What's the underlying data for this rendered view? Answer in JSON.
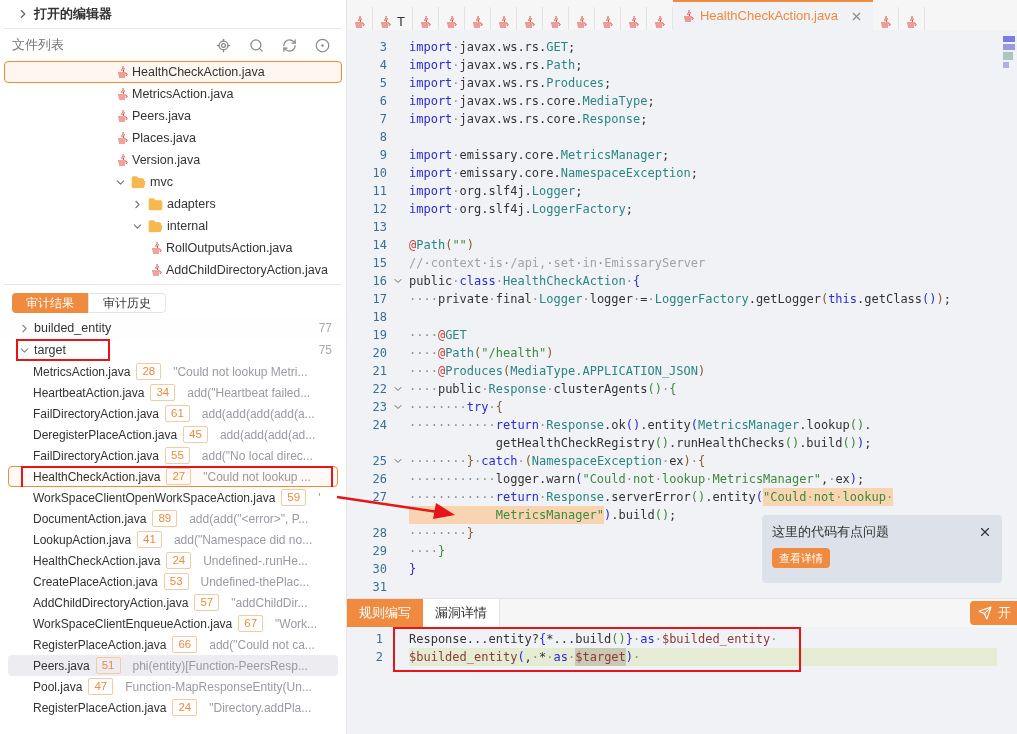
{
  "sidebar": {
    "open_editors": {
      "label": "打开的编辑器",
      "expanded": false
    },
    "file_list": {
      "title": "文件列表"
    },
    "tree": [
      {
        "kind": "file",
        "name": "HealthCheckAction.java",
        "selected": true
      },
      {
        "kind": "file",
        "name": "MetricsAction.java",
        "selected": false
      },
      {
        "kind": "file",
        "name": "Peers.java",
        "selected": false
      },
      {
        "kind": "file",
        "name": "Places.java",
        "selected": false
      },
      {
        "kind": "file",
        "name": "Version.java",
        "selected": false
      },
      {
        "kind": "folder",
        "name": "mvc",
        "expanded": true,
        "selected": false,
        "children": [
          {
            "kind": "folder",
            "name": "adapters",
            "expanded": false,
            "selected": false
          },
          {
            "kind": "folder",
            "name": "internal",
            "expanded": true,
            "selected": false,
            "children": [
              {
                "kind": "file",
                "name": "RollOutputsAction.java",
                "selected": false
              },
              {
                "kind": "file",
                "name": "AddChildDirectoryAction.java",
                "selected": false
              }
            ]
          }
        ]
      }
    ],
    "audit_tabs": [
      {
        "label": "审计结果",
        "selected": true
      },
      {
        "label": "审计历史",
        "selected": false
      }
    ],
    "results": [
      {
        "name": "builded_entity",
        "count": "77",
        "expanded": false,
        "framed": false
      },
      {
        "name": "target",
        "count": "75",
        "expanded": true,
        "framed": true,
        "children": [
          {
            "file": "MetricsAction.java",
            "line": "28",
            "snippet": "\"Could not lookup Metri...",
            "selected": false,
            "hovered": false
          },
          {
            "file": "HeartbeatAction.java",
            "line": "34",
            "snippet": "add(\"Heartbeat failed...",
            "selected": false,
            "hovered": false
          },
          {
            "file": "FailDirectoryAction.java",
            "line": "61",
            "snippet": "add(add(add(add(a...",
            "selected": false,
            "hovered": false
          },
          {
            "file": "DeregisterPlaceAction.java",
            "line": "45",
            "snippet": "add(add(add(ad...",
            "selected": false,
            "hovered": false
          },
          {
            "file": "FailDirectoryAction.java",
            "line": "55",
            "snippet": "add(\"No local direc...",
            "selected": false,
            "hovered": false
          },
          {
            "file": "HealthCheckAction.java",
            "line": "27",
            "snippet": "\"Could not lookup ...",
            "selected": true,
            "hovered": false
          },
          {
            "file": "WorkSpaceClientOpenWorkSpaceAction.java",
            "line": "59",
            "snippet": "'",
            "selected": false,
            "hovered": false
          },
          {
            "file": "DocumentAction.java",
            "line": "89",
            "snippet": "add(add(\"<error>\", P...",
            "selected": false,
            "hovered": false
          },
          {
            "file": "LookupAction.java",
            "line": "41",
            "snippet": "add(\"Namespace did no...",
            "selected": false,
            "hovered": false
          },
          {
            "file": "HealthCheckAction.java",
            "line": "24",
            "snippet": "Undefined-.runHe...",
            "selected": false,
            "hovered": false
          },
          {
            "file": "CreatePlaceAction.java",
            "line": "53",
            "snippet": "Undefined-thePlac...",
            "selected": false,
            "hovered": false
          },
          {
            "file": "AddChildDirectoryAction.java",
            "line": "57",
            "snippet": "\"addChildDir...",
            "selected": false,
            "hovered": false
          },
          {
            "file": "WorkSpaceClientEnqueueAction.java",
            "line": "67",
            "snippet": "\"Work...",
            "selected": false,
            "hovered": false
          },
          {
            "file": "RegisterPlaceAction.java",
            "line": "66",
            "snippet": "add(\"Could not ca...",
            "selected": false,
            "hovered": false
          },
          {
            "file": "Peers.java",
            "line": "51",
            "snippet": "phi(entity)[Function-PeersResp...",
            "selected": false,
            "hovered": true
          },
          {
            "file": "Pool.java",
            "line": "47",
            "snippet": "Function-MapResponseEntity(Un...",
            "selected": false,
            "hovered": false
          },
          {
            "file": "RegisterPlaceAction.java",
            "line": "24",
            "snippet": "\"Directory.addPla...",
            "selected": false,
            "hovered": false
          }
        ]
      }
    ]
  },
  "editor_tabs": [
    {
      "selected": false
    },
    {
      "label": "T",
      "selected": false
    },
    {
      "selected": false
    },
    {
      "selected": false
    },
    {
      "selected": false
    },
    {
      "selected": false
    },
    {
      "selected": false
    },
    {
      "selected": false
    },
    {
      "selected": false
    },
    {
      "selected": false
    },
    {
      "selected": false
    },
    {
      "selected": false
    },
    {
      "label": "HealthCheckAction.java",
      "selected": true
    },
    {
      "selected": false
    },
    {
      "selected": false
    }
  ],
  "code": [
    {
      "kind": "line",
      "number": "3",
      "tokens": [
        {
          "text": "import",
          "kind": "k"
        },
        {
          "text": "·javax.ws.rs.",
          "kind": "p"
        },
        {
          "text": "GET",
          "kind": "t"
        },
        {
          "text": ";",
          "kind": "p"
        }
      ]
    },
    {
      "kind": "line",
      "number": "4",
      "tokens": [
        {
          "text": "import",
          "kind": "k"
        },
        {
          "text": "·javax.ws.rs.",
          "kind": "p"
        },
        {
          "text": "Path",
          "kind": "t"
        },
        {
          "text": ";",
          "kind": "p"
        }
      ]
    },
    {
      "kind": "line",
      "number": "5",
      "tokens": [
        {
          "text": "import",
          "kind": "k"
        },
        {
          "text": "·javax.ws.rs.",
          "kind": "p"
        },
        {
          "text": "Produces",
          "kind": "t"
        },
        {
          "text": ";",
          "kind": "p"
        }
      ]
    },
    {
      "kind": "line",
      "number": "6",
      "tokens": [
        {
          "text": "import",
          "kind": "k"
        },
        {
          "text": "·javax.ws.rs.core.",
          "kind": "p"
        },
        {
          "text": "MediaType",
          "kind": "t"
        },
        {
          "text": ";",
          "kind": "p"
        }
      ]
    },
    {
      "kind": "line",
      "number": "7",
      "tokens": [
        {
          "text": "import",
          "kind": "k"
        },
        {
          "text": "·javax.ws.rs.core.",
          "kind": "p"
        },
        {
          "text": "Response",
          "kind": "t"
        },
        {
          "text": ";",
          "kind": "p"
        }
      ]
    },
    {
      "kind": "line",
      "number": "8"
    },
    {
      "kind": "line",
      "number": "9",
      "tokens": [
        {
          "text": "import",
          "kind": "k"
        },
        {
          "text": "·emissary.core.",
          "kind": "p"
        },
        {
          "text": "MetricsManager",
          "kind": "t"
        },
        {
          "text": ";",
          "kind": "p"
        }
      ]
    },
    {
      "kind": "line",
      "number": "10",
      "tokens": [
        {
          "text": "import",
          "kind": "k"
        },
        {
          "text": "·emissary.core.",
          "kind": "p"
        },
        {
          "text": "NamespaceException",
          "kind": "t"
        },
        {
          "text": ";",
          "kind": "p"
        }
      ]
    },
    {
      "kind": "line",
      "number": "11",
      "tokens": [
        {
          "text": "import",
          "kind": "k"
        },
        {
          "text": "·org.slf4j.",
          "kind": "p"
        },
        {
          "text": "Logger",
          "kind": "t"
        },
        {
          "text": ";",
          "kind": "p"
        }
      ]
    },
    {
      "kind": "line",
      "number": "12",
      "tokens": [
        {
          "text": "import",
          "kind": "k"
        },
        {
          "text": "·org.slf4j.",
          "kind": "p"
        },
        {
          "text": "LoggerFactory",
          "kind": "t"
        },
        {
          "text": ";",
          "kind": "p"
        }
      ]
    },
    {
      "kind": "line",
      "number": "13"
    },
    {
      "kind": "line",
      "number": "14",
      "tokens": [
        {
          "text": "@",
          "kind": "a"
        },
        {
          "text": "Path",
          "kind": "t"
        },
        {
          "text": "(",
          "kind": "b1"
        },
        {
          "text": "\"\"",
          "kind": "s"
        },
        {
          "text": ")",
          "kind": "b1"
        }
      ]
    },
    {
      "kind": "line",
      "number": "15",
      "tokens": [
        {
          "text": "//·context·is·/api,·set·in·EmissaryServer",
          "kind": "c"
        }
      ]
    },
    {
      "kind": "fold",
      "number": "16",
      "tokens": [
        {
          "text": "public·",
          "kind": "p"
        },
        {
          "text": "class",
          "kind": "k"
        },
        {
          "text": "·",
          "kind": "p"
        },
        {
          "text": "HealthCheckAction",
          "kind": "t"
        },
        {
          "text": "·",
          "kind": "p"
        },
        {
          "text": "{",
          "kind": "b2"
        }
      ]
    },
    {
      "kind": "line",
      "number": "17",
      "tokens": [
        {
          "text": "····private·final·",
          "kind": "p"
        },
        {
          "text": "Logger",
          "kind": "t"
        },
        {
          "text": "·logger·=·",
          "kind": "p"
        },
        {
          "text": "LoggerFactory",
          "kind": "t"
        },
        {
          "text": ".getLogger",
          "kind": "p"
        },
        {
          "text": "(",
          "kind": "b1"
        },
        {
          "text": "this",
          "kind": "k"
        },
        {
          "text": ".getClass",
          "kind": "p"
        },
        {
          "text": "()",
          "kind": "b2"
        },
        {
          "text": ")",
          "kind": "b1"
        },
        {
          "text": ";",
          "kind": "p"
        }
      ]
    },
    {
      "kind": "line",
      "number": "18"
    },
    {
      "kind": "line",
      "number": "19",
      "tokens": [
        {
          "text": "····",
          "kind": "p"
        },
        {
          "text": "@",
          "kind": "a"
        },
        {
          "text": "GET",
          "kind": "t"
        }
      ]
    },
    {
      "kind": "line",
      "number": "20",
      "tokens": [
        {
          "text": "····",
          "kind": "p"
        },
        {
          "text": "@",
          "kind": "a"
        },
        {
          "text": "Path",
          "kind": "t"
        },
        {
          "text": "(",
          "kind": "b1"
        },
        {
          "text": "\"/health\"",
          "kind": "s"
        },
        {
          "text": ")",
          "kind": "b1"
        }
      ]
    },
    {
      "kind": "line",
      "number": "21",
      "tokens": [
        {
          "text": "····",
          "kind": "p"
        },
        {
          "text": "@",
          "kind": "a"
        },
        {
          "text": "Produces",
          "kind": "t"
        },
        {
          "text": "(",
          "kind": "b1"
        },
        {
          "text": "MediaType.APPLICATION_JSON",
          "kind": "t"
        },
        {
          "text": ")",
          "kind": "b1"
        }
      ]
    },
    {
      "kind": "fold",
      "number": "22",
      "tokens": [
        {
          "text": "····public·",
          "kind": "p"
        },
        {
          "text": "Response",
          "kind": "t"
        },
        {
          "text": "·clusterAgents",
          "kind": "p"
        },
        {
          "text": "()",
          "kind": "b3"
        },
        {
          "text": "·",
          "kind": "p"
        },
        {
          "text": "{",
          "kind": "b3"
        }
      ]
    },
    {
      "kind": "fold",
      "number": "23",
      "tokens": [
        {
          "text": "········",
          "kind": "p"
        },
        {
          "text": "try",
          "kind": "k"
        },
        {
          "text": "·",
          "kind": "p"
        },
        {
          "text": "{",
          "kind": "b1"
        }
      ]
    },
    {
      "kind": "line",
      "number": "24",
      "tokens": [
        {
          "text": "············",
          "kind": "p"
        },
        {
          "text": "return",
          "kind": "k"
        },
        {
          "text": "·",
          "kind": "p"
        },
        {
          "text": "Response",
          "kind": "t"
        },
        {
          "text": ".ok",
          "kind": "p"
        },
        {
          "text": "()",
          "kind": "b2"
        },
        {
          "text": ".entity",
          "kind": "p"
        },
        {
          "text": "(",
          "kind": "b2"
        },
        {
          "text": "MetricsManager",
          "kind": "t"
        },
        {
          "text": ".lookup",
          "kind": "p"
        },
        {
          "text": "()",
          "kind": "b3"
        },
        {
          "text": ".",
          "kind": "p"
        }
      ]
    },
    {
      "kind": "wrap",
      "tokens": [
        {
          "text": "getHealthCheckRegistry",
          "kind": "p"
        },
        {
          "text": "()",
          "kind": "b3"
        },
        {
          "text": ".runHealthChecks",
          "kind": "p"
        },
        {
          "text": "()",
          "kind": "b3"
        },
        {
          "text": ".build",
          "kind": "p"
        },
        {
          "text": "()",
          "kind": "b3"
        },
        {
          "text": ")",
          "kind": "b2"
        },
        {
          "text": ";",
          "kind": "p"
        }
      ]
    },
    {
      "kind": "fold",
      "number": "25",
      "tokens": [
        {
          "text": "········",
          "kind": "p"
        },
        {
          "text": "}",
          "kind": "b1"
        },
        {
          "text": "·",
          "kind": "p"
        },
        {
          "text": "catch",
          "kind": "k"
        },
        {
          "text": "·",
          "kind": "p"
        },
        {
          "text": "(",
          "kind": "b1"
        },
        {
          "text": "NamespaceException",
          "kind": "t"
        },
        {
          "text": "·ex",
          "kind": "p"
        },
        {
          "text": ")",
          "kind": "b1"
        },
        {
          "text": "·",
          "kind": "p"
        },
        {
          "text": "{",
          "kind": "b1"
        }
      ]
    },
    {
      "kind": "line",
      "number": "26",
      "tokens": [
        {
          "text": "············logger.warn",
          "kind": "p"
        },
        {
          "text": "(",
          "kind": "b2"
        },
        {
          "text": "\"Could·not·lookup·MetricsManager\"",
          "kind": "s"
        },
        {
          "text": ",·ex",
          "kind": "p"
        },
        {
          "text": ")",
          "kind": "b2"
        },
        {
          "text": ";",
          "kind": "p"
        }
      ]
    },
    {
      "kind": "line",
      "number": "27",
      "tokens": [
        {
          "text": "············",
          "kind": "p"
        },
        {
          "text": "return",
          "kind": "k"
        },
        {
          "text": "·",
          "kind": "p"
        },
        {
          "text": "Response",
          "kind": "t"
        },
        {
          "text": ".serverError",
          "kind": "p"
        },
        {
          "text": "()",
          "kind": "b3"
        },
        {
          "text": ".entity",
          "kind": "p"
        },
        {
          "text": "(",
          "kind": "b2"
        },
        {
          "text": "\"Could·not·lookup·",
          "kind": "s_mark"
        }
      ]
    },
    {
      "kind": "wrap_mark",
      "tokens": [
        {
          "text": "MetricsManager\"",
          "kind": "s_mark"
        },
        {
          "text": ")",
          "kind": "b2"
        },
        {
          "text": ".build",
          "kind": "p"
        },
        {
          "text": "()",
          "kind": "b3"
        },
        {
          "text": ";",
          "kind": "p"
        }
      ]
    },
    {
      "kind": "line",
      "number": "28",
      "tokens": [
        {
          "text": "········",
          "kind": "p"
        },
        {
          "text": "}",
          "kind": "b1"
        }
      ]
    },
    {
      "kind": "line",
      "number": "29",
      "tokens": [
        {
          "text": "····",
          "kind": "p"
        },
        {
          "text": "}",
          "kind": "b3"
        }
      ]
    },
    {
      "kind": "line",
      "number": "30",
      "tokens": [
        {
          "text": "}",
          "kind": "b2"
        }
      ]
    },
    {
      "kind": "line",
      "number": "31"
    }
  ],
  "popup": {
    "message": "这里的代码有点问题",
    "button": "查看详情"
  },
  "bottom_tabs": [
    {
      "label": "规则编写",
      "selected": true
    },
    {
      "label": "漏洞详情",
      "selected": false
    }
  ],
  "start_button": {
    "label": "开"
  },
  "rule": [
    {
      "number": "1",
      "current": false,
      "tokens": [
        {
          "text": "Response...entity?",
          "kind": "p"
        },
        {
          "text": "{",
          "kind": "b2"
        },
        {
          "text": "*...build",
          "kind": "p"
        },
        {
          "text": "()",
          "kind": "b3"
        },
        {
          "text": "}",
          "kind": "b2"
        },
        {
          "text": "·",
          "kind": "p"
        },
        {
          "text": "as",
          "kind": "k"
        },
        {
          "text": "·",
          "kind": "p"
        },
        {
          "text": "$builded_entity",
          "kind": "v"
        },
        {
          "text": "·",
          "kind": "p"
        }
      ]
    },
    {
      "number": "2",
      "current": true,
      "tokens": [
        {
          "text": "$builded_entity",
          "kind": "v"
        },
        {
          "text": "(",
          "kind": "b2"
        },
        {
          "text": ",·*·",
          "kind": "p"
        },
        {
          "text": "as",
          "kind": "k"
        },
        {
          "text": "·",
          "kind": "p"
        },
        {
          "text": "$target",
          "kind": "v_sel"
        },
        {
          "text": ")",
          "kind": "b2"
        },
        {
          "text": "·",
          "kind": "p"
        }
      ]
    }
  ]
}
